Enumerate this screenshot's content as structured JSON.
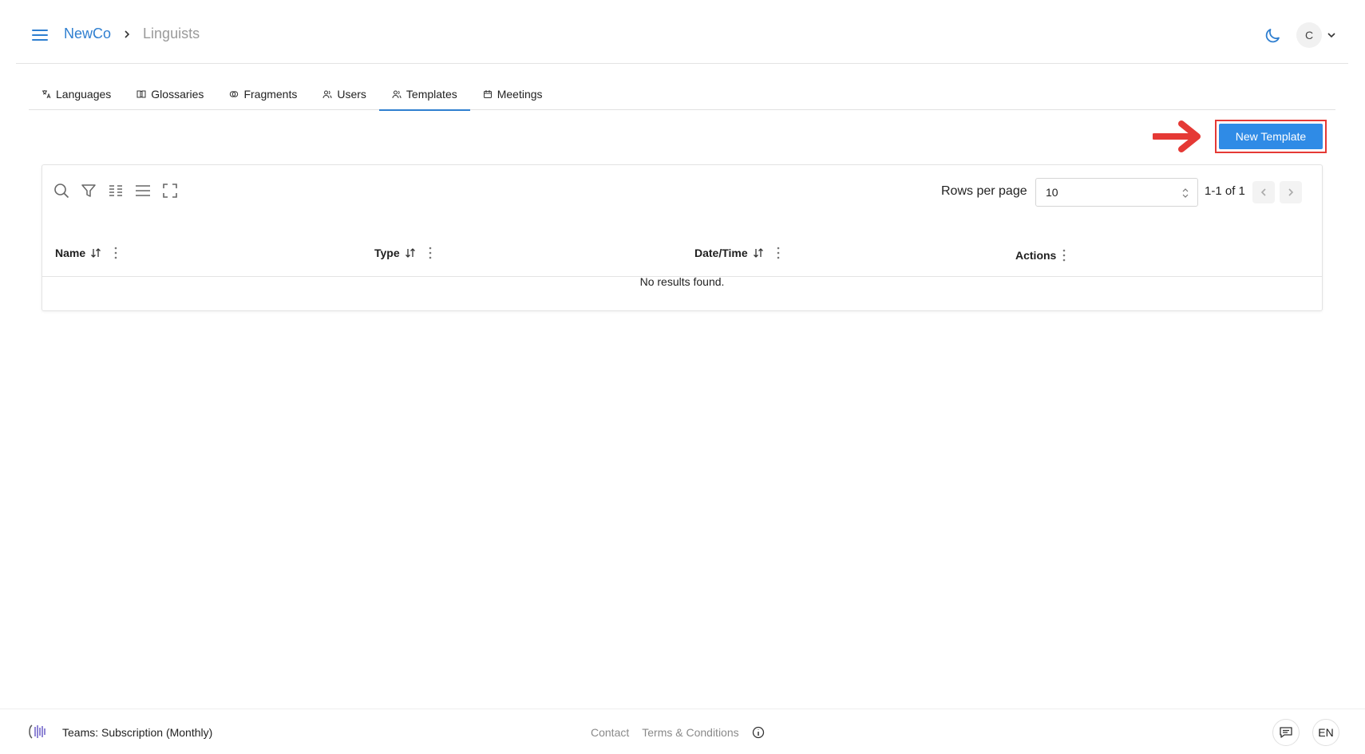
{
  "header": {
    "breadcrumb_org": "NewCo",
    "breadcrumb_current": "Linguists",
    "user_initial": "C"
  },
  "tabs": [
    {
      "label": "Languages",
      "icon": "translate-icon",
      "active": false
    },
    {
      "label": "Glossaries",
      "icon": "book-icon",
      "active": false
    },
    {
      "label": "Fragments",
      "icon": "fragments-icon",
      "active": false
    },
    {
      "label": "Users",
      "icon": "users-icon",
      "active": false
    },
    {
      "label": "Templates",
      "icon": "users-icon",
      "active": true
    },
    {
      "label": "Meetings",
      "icon": "calendar-icon",
      "active": false
    }
  ],
  "actions": {
    "new_template_label": "New Template"
  },
  "table": {
    "rows_per_page_label": "Rows per page",
    "rows_per_page_value": "10",
    "page_info": "1-1 of 1",
    "columns": [
      "Name",
      "Type",
      "Date/Time",
      "Actions"
    ],
    "empty_message": "No results found."
  },
  "footer": {
    "plan": "Teams: Subscription (Monthly)",
    "contact": "Contact",
    "terms": "Terms & Conditions",
    "language": "EN"
  },
  "colors": {
    "accent": "#2f8be6",
    "link": "#2f7fd0",
    "highlight": "#e53935"
  }
}
